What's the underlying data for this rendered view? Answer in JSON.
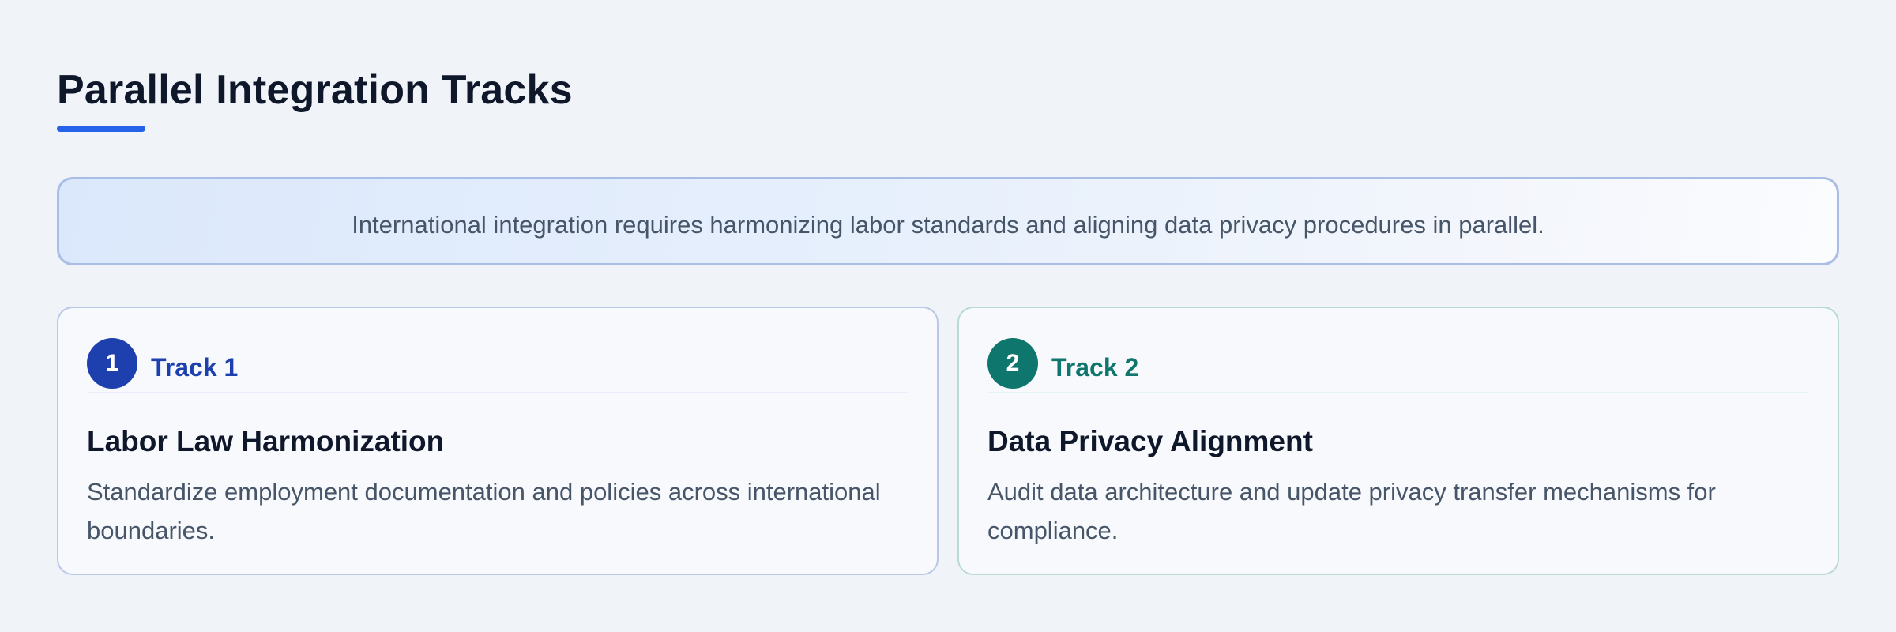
{
  "header": {
    "title": "Parallel Integration Tracks"
  },
  "banner": {
    "text": "International integration requires harmonizing labor standards and aligning data privacy procedures in parallel."
  },
  "tracks": [
    {
      "number": "1",
      "label": "Track 1",
      "title": "Labor Law Harmonization",
      "description": "Standardize employment documentation and policies across international boundaries.",
      "color": "#1e40af"
    },
    {
      "number": "2",
      "label": "Track 2",
      "title": "Data Privacy Alignment",
      "description": "Audit data architecture and update privacy transfer mechanisms for compliance.",
      "color": "#0f766e"
    }
  ],
  "colors": {
    "accent": "#2563eb",
    "background": "#f0f3f8"
  }
}
